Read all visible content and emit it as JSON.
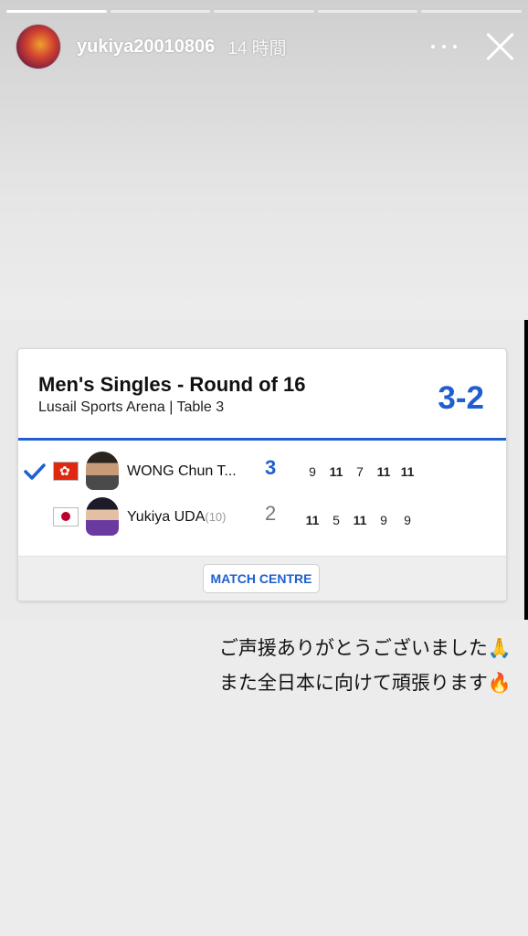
{
  "story": {
    "progress_segments": 5,
    "active_segment": 1,
    "username": "yukiya20010806",
    "time": "14 時間"
  },
  "card": {
    "title": "Men's Singles - Round of 16",
    "subtitle": "Lusail Sports Arena | Table 3",
    "score": "3-2",
    "players": [
      {
        "name": "WONG Chun T...",
        "seed": "",
        "games": "3",
        "sets": [
          "9",
          "11",
          "7",
          "11",
          "11"
        ],
        "winner": true,
        "flag": "hong-kong-flag-icon"
      },
      {
        "name": "Yukiya UDA",
        "seed": "(10)",
        "games": "2",
        "sets": [
          "11",
          "5",
          "11",
          "9",
          "9"
        ],
        "winner": false,
        "flag": "japan-flag-icon"
      }
    ],
    "button_label": "MATCH CENTRE"
  },
  "caption": {
    "line1": "ご声援ありがとうございました",
    "line2": "また全日本に向けて頑張ります",
    "emoji1": "🙏",
    "emoji2": "🔥"
  },
  "colors": {
    "accent": "#1f5fcf",
    "winner": "#1f5fcf",
    "hk_red": "#de2910",
    "jp_red": "#bc002d"
  }
}
